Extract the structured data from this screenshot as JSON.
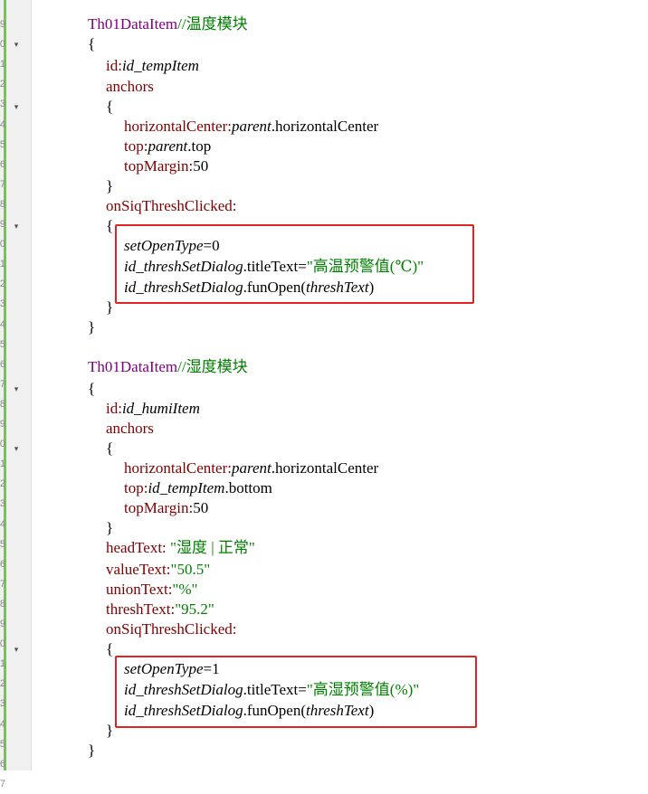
{
  "line_numbers": [
    "9",
    "0",
    "1",
    "2",
    "3",
    "4",
    "5",
    "6",
    "7",
    "8",
    "9",
    "0",
    "1",
    "2",
    "3",
    "4",
    "5",
    "6",
    "7",
    "8",
    "9",
    "0",
    "1",
    "2",
    "3",
    "4",
    "5",
    "6",
    "7",
    "8",
    "9",
    "0",
    "1",
    "2",
    "3",
    "4",
    "5",
    "6",
    "7"
  ],
  "code": {
    "block1": {
      "type": "Th01DataItem",
      "comment": "//温度模块",
      "open_brace": "{",
      "id_key": "id:",
      "id_val": "id_tempItem",
      "anchors": "anchors",
      "anchors_open": "{",
      "hc_key": "horizontalCenter:",
      "hc_parent": "parent",
      "hc_rest": ".horizontalCenter",
      "top_key": "top:",
      "top_parent": "parent",
      "top_rest": ".top",
      "tm_key": "topMargin:",
      "tm_val": "50",
      "anchors_close": "}",
      "handler": "onSiqThreshClicked:",
      "handler_open": "{",
      "set_name": "setOpenType",
      "set_rest": "=0",
      "dlg1": "id_threshSetDialog",
      "title_prop": ".titleText=",
      "title_str": "\"高温预警值(℃)\"",
      "dlg2": "id_threshSetDialog",
      "fun": ".funOpen(",
      "arg": "threshText",
      "close_paren": ")",
      "handler_close": "}",
      "close_brace": "}"
    },
    "block2": {
      "type": "Th01DataItem",
      "comment": "//湿度模块",
      "open_brace": "{",
      "id_key": "id:",
      "id_val": "id_humiItem",
      "anchors": "anchors",
      "anchors_open": "{",
      "hc_key": "horizontalCenter:",
      "hc_parent": "parent",
      "hc_rest": ".horizontalCenter",
      "top_key": "top:",
      "top_ref": "id_tempItem",
      "top_rest": ".bottom",
      "tm_key": "topMargin:",
      "tm_val": "50",
      "anchors_close": "}",
      "head_key": "headText: ",
      "head_val": "\"湿度 | 正常\"",
      "value_key": "valueText:",
      "value_val": "\"50.5\"",
      "union_key": "unionText:",
      "union_val": "\"%\"",
      "thresh_key": "threshText:",
      "thresh_val": "\"95.2\"",
      "handler": "onSiqThreshClicked:",
      "handler_open": "{",
      "set_name": "setOpenType",
      "set_rest": "=1",
      "dlg1": "id_threshSetDialog",
      "title_prop": ".titleText=",
      "title_str": "\"高湿预警值(%)\"",
      "dlg2": "id_threshSetDialog",
      "fun": ".funOpen(",
      "arg": "threshText",
      "close_paren": ")",
      "handler_close": "}",
      "close_brace": "}"
    }
  },
  "colors": {
    "type": "#800080",
    "property": "#800000",
    "comment": "#008000",
    "string": "#008000",
    "highlight_box": "#e02424",
    "change_bar": "#7cbf5e"
  },
  "fold_marker": "▾"
}
